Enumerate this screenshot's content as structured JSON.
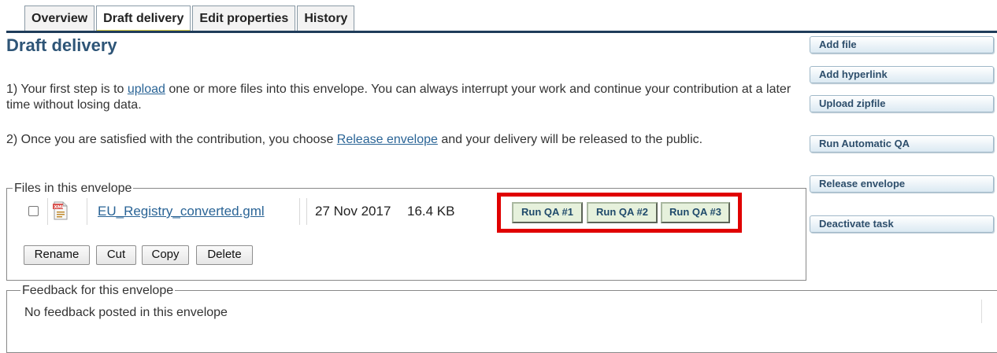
{
  "tabs": [
    {
      "label": "Overview",
      "active": false
    },
    {
      "label": "Draft delivery",
      "active": true
    },
    {
      "label": "Edit properties",
      "active": false
    },
    {
      "label": "History",
      "active": false
    }
  ],
  "page_title": "Draft delivery",
  "instructions": {
    "step1_prefix": "1) Your first step is to ",
    "step1_link": "upload",
    "step1_suffix": " one or more files into this envelope. You can always interrupt your work and continue your contribution at a later time without losing data.",
    "step2_prefix": "2) Once you are satisfied with the contribution, you choose ",
    "step2_link": "Release envelope",
    "step2_suffix": " and your delivery will be released to the public."
  },
  "side_actions": [
    "Add file",
    "Add hyperlink",
    "Upload zipfile",
    "Run Automatic QA",
    "Release envelope",
    "Deactivate task"
  ],
  "files_section": {
    "legend": "Files in this envelope",
    "files": [
      {
        "name": "EU_Registry_converted.gml",
        "date": "27 Nov 2017",
        "size": "16.4 KB",
        "icon": "xml-file-icon",
        "checked": false,
        "qa_buttons": [
          "Run QA #1",
          "Run QA #2",
          "Run QA #3"
        ]
      }
    ],
    "actions": [
      "Rename",
      "Cut",
      "Copy",
      "Delete"
    ]
  },
  "feedback_section": {
    "legend": "Feedback for this envelope",
    "message": "No feedback posted in this envelope"
  },
  "colors": {
    "accent": "#2e5577",
    "link": "#2a6496",
    "highlight": "#e00000",
    "tab_underline": "#e8d84a"
  }
}
